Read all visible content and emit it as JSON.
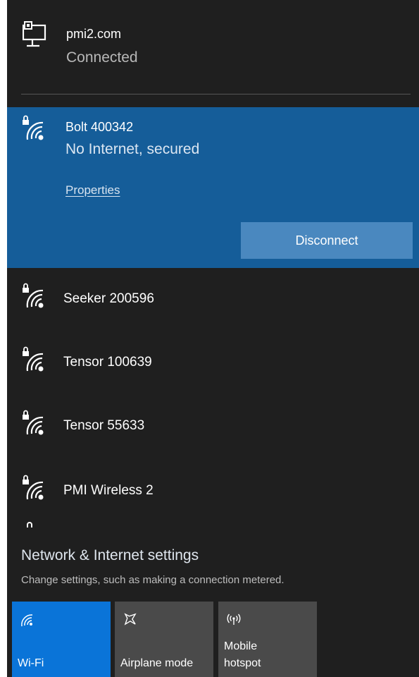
{
  "connected_network": {
    "name": "pmi2.com",
    "status": "Connected",
    "icon": "ethernet-monitor-icon"
  },
  "selected_network": {
    "name": "Bolt 400342",
    "status": "No Internet, secured",
    "properties_label": "Properties",
    "disconnect_label": "Disconnect",
    "icon": "wifi-secured-icon"
  },
  "networks": [
    {
      "name": "Seeker 200596",
      "icon": "wifi-secured-icon"
    },
    {
      "name": "Tensor 100639",
      "icon": "wifi-secured-icon"
    },
    {
      "name": "Tensor 55633",
      "icon": "wifi-secured-icon"
    },
    {
      "name": "PMI Wireless 2",
      "icon": "wifi-secured-icon"
    }
  ],
  "settings": {
    "title": "Network & Internet settings",
    "description": "Change settings, such as making a connection metered."
  },
  "quick_actions": [
    {
      "label": "Wi-Fi",
      "active": true,
      "icon": "wifi-icon"
    },
    {
      "label": "Airplane mode",
      "active": false,
      "icon": "airplane-icon"
    },
    {
      "label_line1": "Mobile",
      "label_line2": "hotspot",
      "active": false,
      "icon": "hotspot-icon"
    }
  ],
  "colors": {
    "panel_bg": "#1f1f1f",
    "selected_bg": "#155d99",
    "button_bg": "#4a88bf",
    "active_tile": "#0a74d8",
    "inactive_tile": "#4a4a4a"
  }
}
